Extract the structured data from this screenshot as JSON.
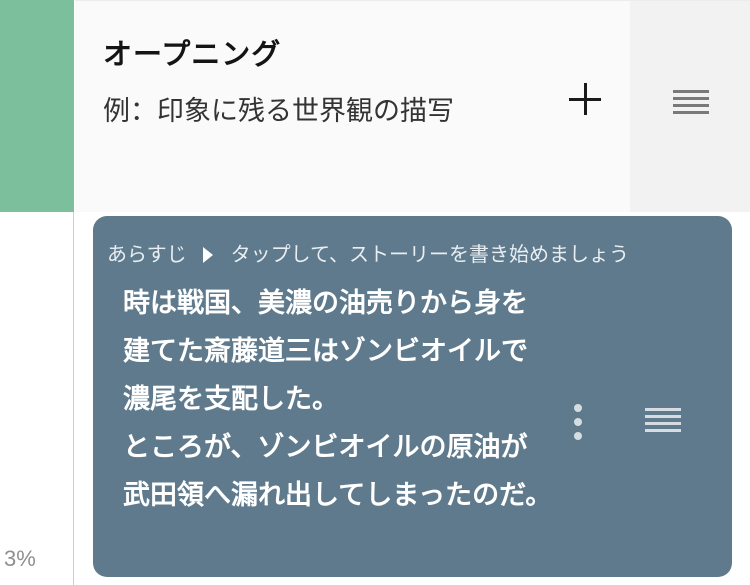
{
  "theme": {
    "rail_accent": "#7bbf9c",
    "synopsis_card_bg": "#5e7a8c"
  },
  "rail": {
    "progress_text": "3%"
  },
  "chapter": {
    "title": "オープニング",
    "description": "例：印象に残る世界観の描写",
    "add_icon": "plus-icon",
    "handle_icon": "drag-handle-icon"
  },
  "synopsis": {
    "label": "あらすじ",
    "hint": "タップして、ストーリーを書き始めましょう",
    "body": "時は戦国、美濃の油売りから身を建てた斎藤道三はゾンビオイルで濃尾を支配した。\nところが、ゾンビオイルの原油が武田領へ漏れ出してしまったのだ。",
    "more_icon": "more-vertical-icon",
    "handle_icon": "drag-handle-icon"
  }
}
